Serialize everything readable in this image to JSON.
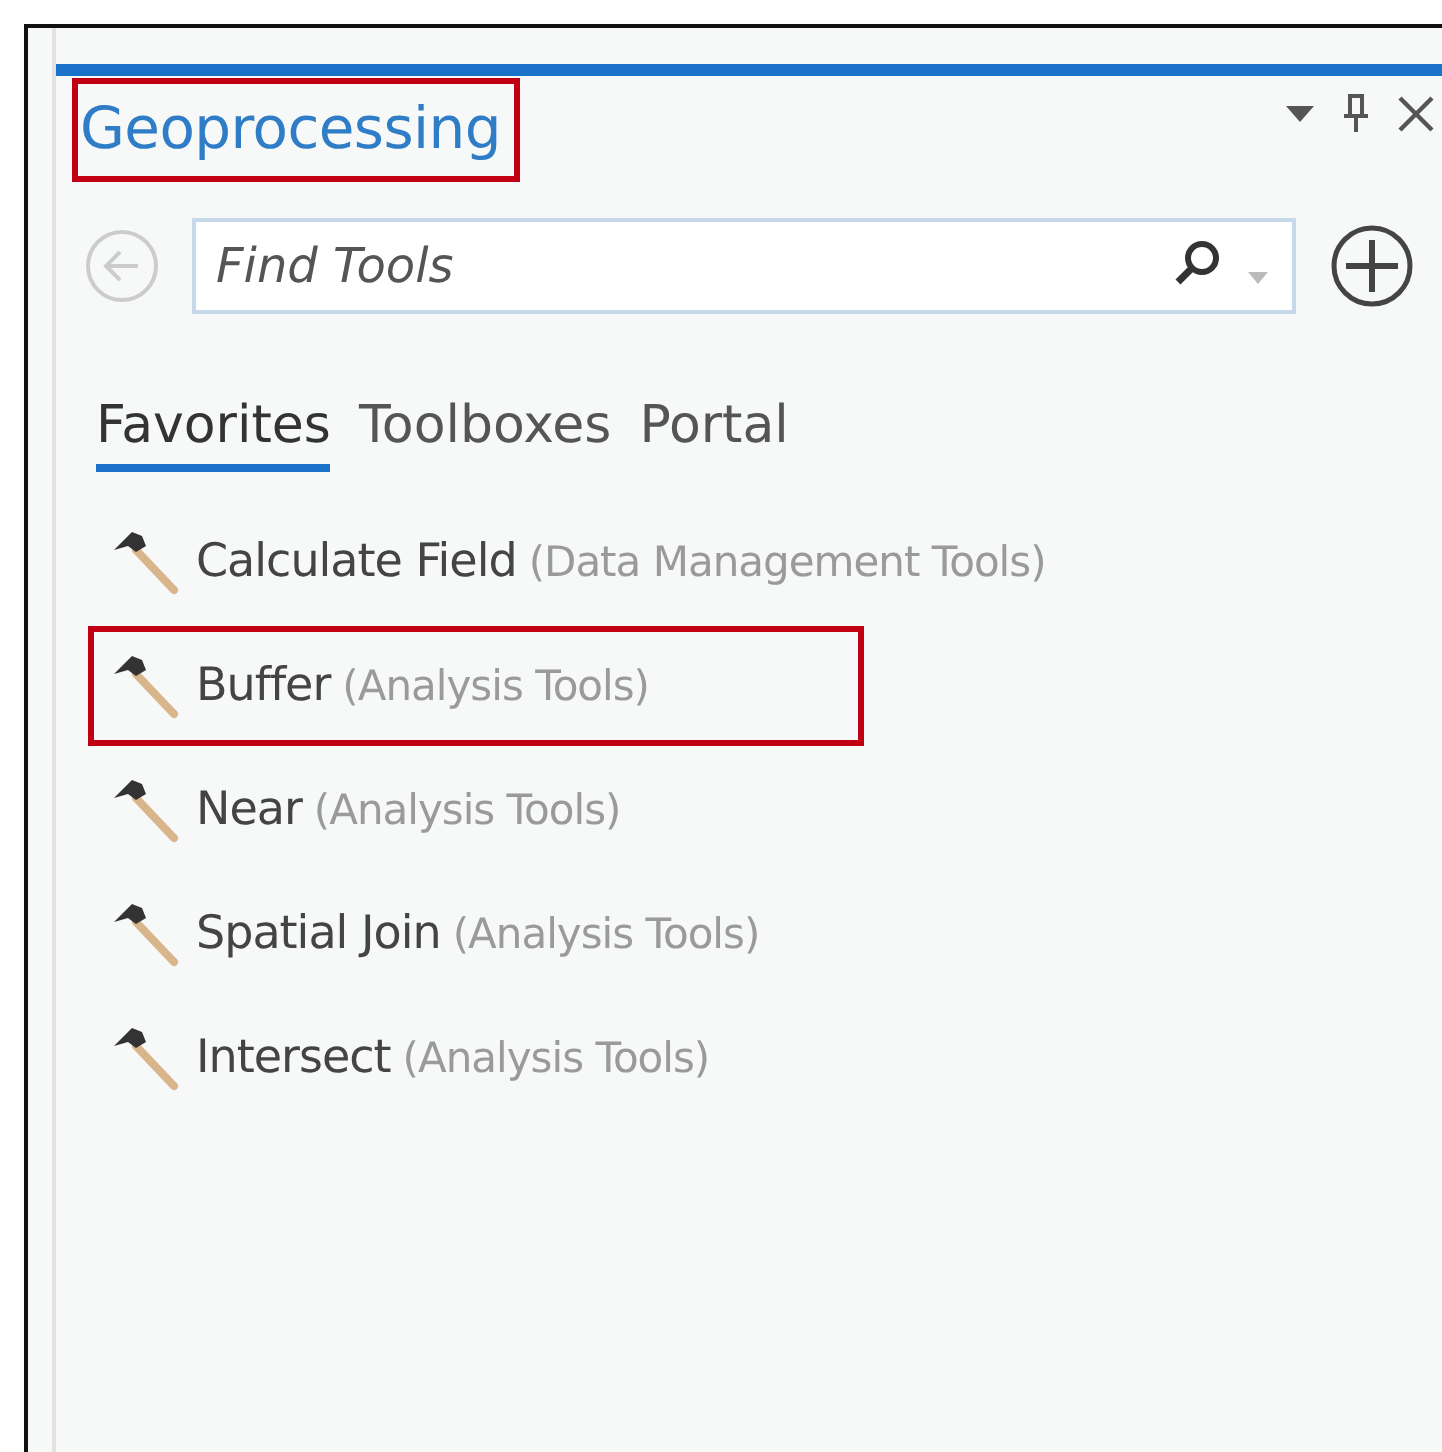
{
  "pane": {
    "title": "Geoprocessing",
    "title_highlighted": true
  },
  "search": {
    "placeholder": "Find Tools"
  },
  "tabs": [
    {
      "label": "Favorites",
      "selected": true
    },
    {
      "label": "Toolboxes",
      "selected": false
    },
    {
      "label": "Portal",
      "selected": false
    }
  ],
  "tools": [
    {
      "name": "Calculate Field",
      "toolbox": "(Data Management Tools)",
      "highlighted": false
    },
    {
      "name": "Buffer",
      "toolbox": "(Analysis Tools)",
      "highlighted": true
    },
    {
      "name": "Near",
      "toolbox": "(Analysis Tools)",
      "highlighted": false
    },
    {
      "name": "Spatial Join",
      "toolbox": "(Analysis Tools)",
      "highlighted": false
    },
    {
      "name": "Intersect",
      "toolbox": "(Analysis Tools)",
      "highlighted": false
    }
  ]
}
